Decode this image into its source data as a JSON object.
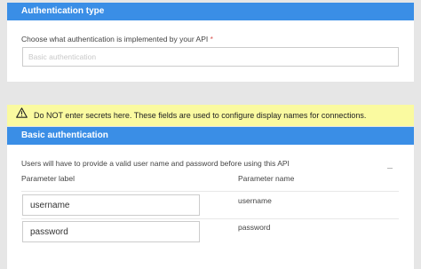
{
  "auth_type": {
    "title": "Authentication type",
    "label": "Choose what authentication is implemented by your API",
    "required_marker": "*",
    "selected_value": "Basic authentication"
  },
  "warning": {
    "icon": "warning-icon",
    "text": "Do NOT enter secrets here. These fields are used to configure display names for connections."
  },
  "basic_auth": {
    "title": "Basic authentication",
    "description": "Users will have to provide a valid user name and password before using this API",
    "columns": {
      "label": "Parameter label",
      "name": "Parameter name"
    },
    "rows": [
      {
        "label_value": "username",
        "name": "username"
      },
      {
        "label_value": "password",
        "name": "password"
      }
    ]
  },
  "colors": {
    "header": "#3a8ee6",
    "warning_bg": "#fafaa0",
    "page_bg": "#e6e6e6",
    "required": "#d9534f"
  }
}
